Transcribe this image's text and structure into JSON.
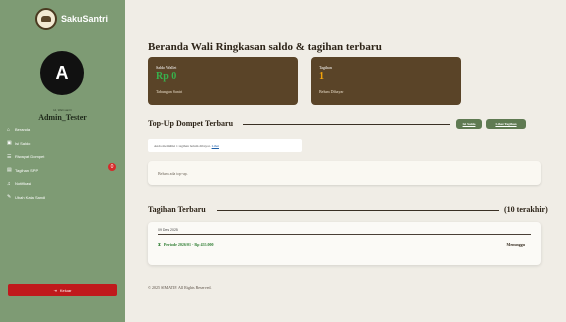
{
  "app": {
    "brand": "SakuSantri",
    "avatar_initial": "A",
    "greeting": "Hi, Wali santri",
    "username": "Admin_Tester"
  },
  "nav": [
    {
      "label": "Beranda",
      "icon": "home-icon",
      "glyph": "⌂"
    },
    {
      "label": "Isi Saldo",
      "icon": "wallet-icon",
      "glyph": "▣"
    },
    {
      "label": "Riwayat Dompet",
      "icon": "history-icon",
      "glyph": "☰"
    },
    {
      "label": "Tagihan SPP",
      "icon": "invoice-icon",
      "glyph": "▤"
    },
    {
      "label": "Notifikasi",
      "icon": "bell-icon",
      "glyph": "♫",
      "badge": "0"
    },
    {
      "label": "Ubah Kata Sandi",
      "icon": "key-icon",
      "glyph": "✎"
    }
  ],
  "logout": {
    "label": "Keluar",
    "icon": "logout-icon",
    "glyph": "⇥"
  },
  "main": {
    "title": "Beranda Wali Ringkasan saldo & tagihan terbaru",
    "cards": [
      {
        "title": "Saldo Wallet",
        "value": "Rp 0",
        "sub": "Tabungan Santri"
      },
      {
        "title": "Tagihan",
        "value": "1",
        "sub": "Belum Dibayar"
      }
    ],
    "topup": {
      "heading": "Top-Up Dompet Terbaru",
      "btn_topup": "Isi Saldo",
      "btn_all": "Lihat Tagihan",
      "note_text": "Anda memiliki 1 tagihan belum dibayar.",
      "note_link": "Lihat",
      "empty": "Belum ada top-up."
    },
    "bills": {
      "heading": "Tagihan Terbaru",
      "count_label": "(10 terakhir)",
      "date": "09 Des 2025",
      "item": "Periode 2026/01 - Rp 455.000",
      "status": "Menunggu"
    },
    "footer": "© 2025 SIMATIF. All Rights Reserved."
  },
  "colors": {
    "sidebar": "#7e9b74",
    "card": "#5a4428",
    "saldo_value": "#37b24d",
    "tagihan_value": "#f4a40a",
    "logout": "#c0191c",
    "button": "#5f7a52",
    "badge": "#d62a2a"
  }
}
